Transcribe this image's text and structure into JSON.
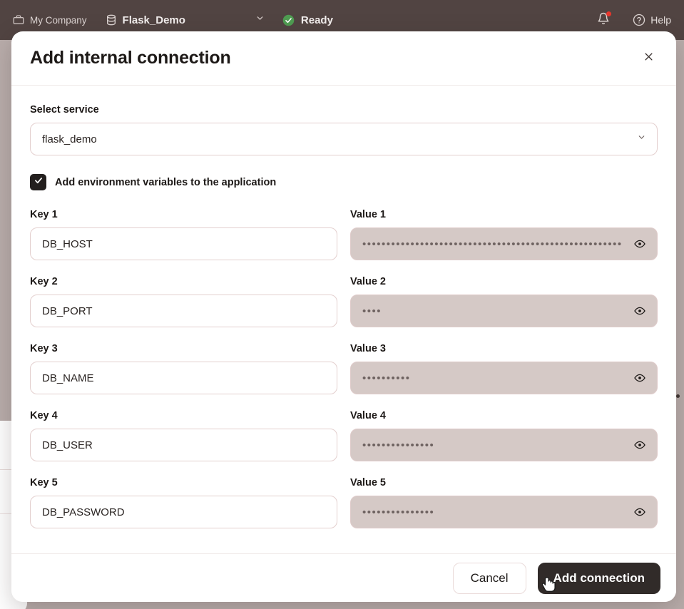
{
  "app_bar": {
    "company": {
      "label": "My Company",
      "icon": "briefcase-icon"
    },
    "project": {
      "label": "Flask_Demo",
      "icon": "database-icon"
    },
    "project_chevron_icon": "chevron-down-icon",
    "status": {
      "label": "Ready",
      "icon": "check-circle-icon",
      "color": "#4f9d52"
    },
    "notifications": {
      "icon": "bell-icon",
      "has_unread": true,
      "dot_color": "#e8362c"
    },
    "help": {
      "label": "Help",
      "icon": "question-circle-icon"
    },
    "background_color": "#514442"
  },
  "modal": {
    "title": "Add internal connection",
    "close_icon": "close-icon",
    "select_service": {
      "label": "Select service",
      "value": "flask_demo",
      "placeholder": "Select service",
      "chevron_icon": "chevron-down-icon"
    },
    "env_checkbox": {
      "label": "Add environment variables to the application",
      "checked": true,
      "icon": "check-icon"
    },
    "pairs": [
      {
        "key_label": "Key 1",
        "key_value": "DB_HOST",
        "value_label": "Value 1",
        "value_masked": "••••••••••••••••••••••••••••••••••••••••••••••••••••••",
        "reveal_icon": "eye-icon"
      },
      {
        "key_label": "Key 2",
        "key_value": "DB_PORT",
        "value_label": "Value 2",
        "value_masked": "••••",
        "reveal_icon": "eye-icon"
      },
      {
        "key_label": "Key 3",
        "key_value": "DB_NAME",
        "value_label": "Value 3",
        "value_masked": "••••••••••",
        "reveal_icon": "eye-icon"
      },
      {
        "key_label": "Key 4",
        "key_value": "DB_USER",
        "value_label": "Value 4",
        "value_masked": "•••••••••••••••",
        "reveal_icon": "eye-icon"
      },
      {
        "key_label": "Key 5",
        "key_value": "DB_PASSWORD",
        "value_label": "Value 5",
        "value_masked": "•••••••••••••••",
        "reveal_icon": "eye-icon"
      }
    ],
    "footer": {
      "cancel_label": "Cancel",
      "submit_label": "Add connection"
    }
  },
  "colors": {
    "backdrop": "#b9adab",
    "topbar": "#514442",
    "primary_button": "#312b29",
    "input_border": "#e3cfce",
    "masked_field_bg": "#d5c9c6"
  }
}
